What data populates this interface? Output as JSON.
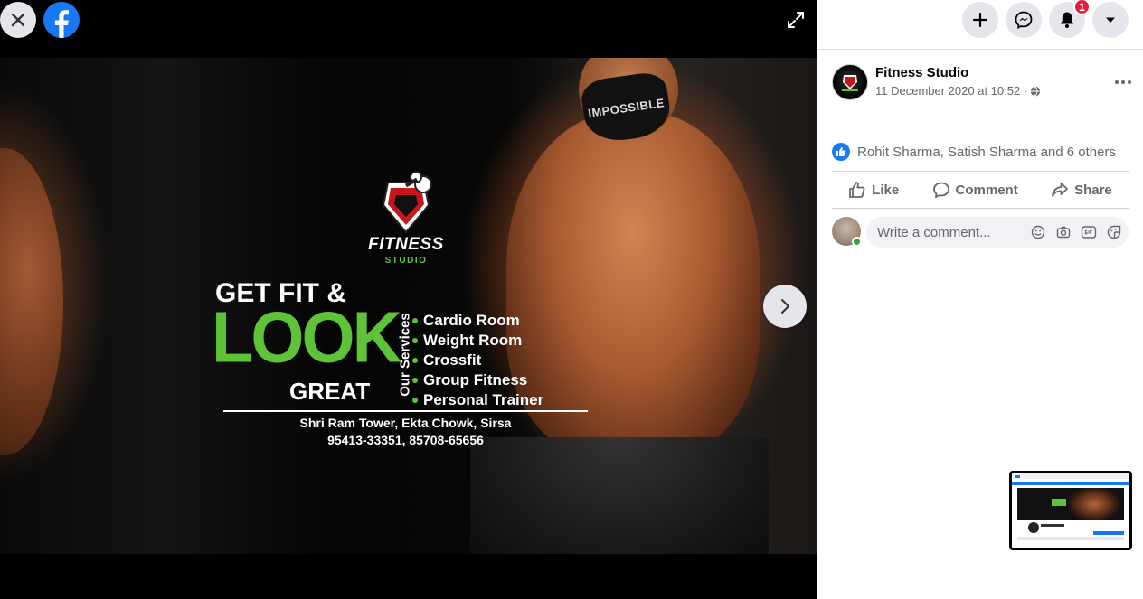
{
  "viewer": {
    "close_icon": "close-icon",
    "logo_icon": "facebook-logo-icon",
    "expand_icon": "fullscreen-icon",
    "next_icon": "chevron-right-icon"
  },
  "poster": {
    "brand_name": "FITNESS",
    "brand_sub": "STUDIO",
    "headline_1": "GET FIT &",
    "headline_2": "LOOK",
    "headline_3": "GREAT",
    "services_label": "Our Services",
    "services": [
      "Cardio Room",
      "Weight Room",
      "Crossfit",
      "Group Fitness",
      "Personal Trainer"
    ],
    "address": "Shri Ram Tower, Ekta Chowk, Sirsa",
    "phones": "95413-33351, 85708-65656",
    "mask_text": "IMPOSSIBLE",
    "accent_color": "#5fc338"
  },
  "topbar": {
    "create_icon": "plus-icon",
    "messenger_icon": "messenger-icon",
    "notifications_icon": "bell-icon",
    "notifications_count": "1",
    "account_icon": "caret-down-icon"
  },
  "post": {
    "page_name": "Fitness Studio",
    "timestamp": "11 December 2020 at 10:52 · ",
    "privacy_icon": "globe-icon",
    "reactions_text": "Rohit Sharma, Satish Sharma and 6 others",
    "actions": {
      "like": "Like",
      "comment": "Comment",
      "share": "Share"
    },
    "comment_placeholder": "Write a comment...",
    "comment_icons": [
      "emoji-icon",
      "camera-icon",
      "gif-icon",
      "sticker-icon"
    ]
  },
  "colors": {
    "facebook_blue": "#1877f2",
    "badge_red": "#e41e3f",
    "online_green": "#31a24c"
  }
}
